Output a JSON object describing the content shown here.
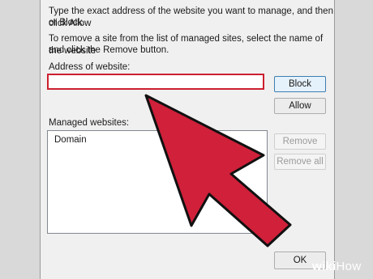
{
  "dialog": {
    "instructions_line1": "Type the exact address of the website you want to manage, and then click Allow",
    "instructions_line1b": "or Block.",
    "instructions_line2": "To remove a site from the list of managed sites, select the name of the website",
    "instructions_line2b": "and click the Remove button.",
    "address_label": "Address of website:",
    "address_value": "",
    "managed_label": "Managed websites:",
    "list_column_header": "Domain",
    "buttons": {
      "block": "Block",
      "allow": "Allow",
      "remove": "Remove",
      "remove_all": "Remove all",
      "ok": "OK"
    }
  },
  "overlay": {
    "arrow_color": "#d0203a",
    "arrow_outline": "#111111"
  },
  "watermark": {
    "part1": "wiki",
    "part2": "How"
  }
}
